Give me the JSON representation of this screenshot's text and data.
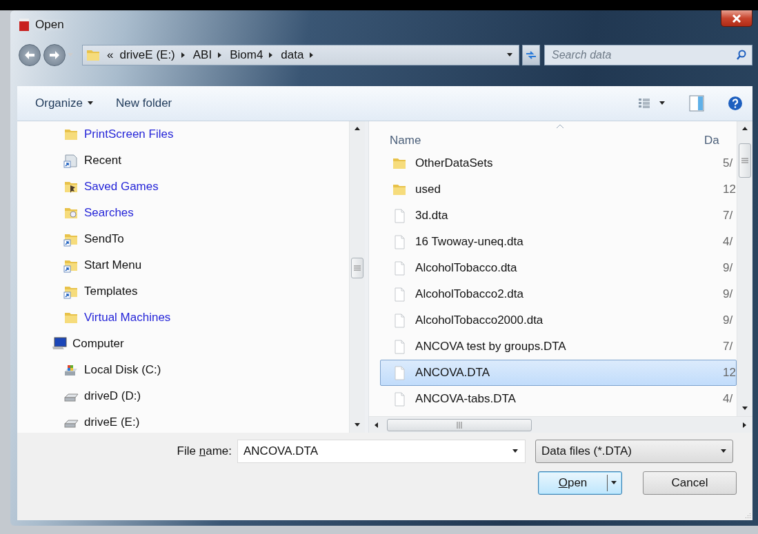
{
  "window": {
    "title": "Open"
  },
  "address_bar": {
    "overflow": "«",
    "path": [
      "driveE (E:)",
      "ABI",
      "Biom4",
      "data"
    ]
  },
  "search": {
    "placeholder": "Search data"
  },
  "toolbar": {
    "buttons": [
      {
        "label": "Organize",
        "dropdown": true
      },
      {
        "label": "New folder",
        "dropdown": false
      }
    ]
  },
  "navigation": {
    "tree": [
      {
        "children": [
          {
            "label": "PrintScreen Files",
            "kind": "folder",
            "compressed": true
          },
          {
            "label": "Recent",
            "kind": "recent",
            "compressed": false
          },
          {
            "label": "Saved Games",
            "kind": "saved-games",
            "compressed": true
          },
          {
            "label": "Searches",
            "kind": "searches",
            "compressed": true
          },
          {
            "label": "SendTo",
            "kind": "shortcut",
            "compressed": false
          },
          {
            "label": "Start Menu",
            "kind": "shortcut",
            "compressed": false
          },
          {
            "label": "Templates",
            "kind": "shortcut",
            "compressed": false
          },
          {
            "label": "Virtual Machines",
            "kind": "folder",
            "compressed": true
          }
        ]
      },
      {
        "label": "Computer",
        "kind": "computer",
        "compressed": false,
        "children": [
          {
            "label": "Local Disk (C:)",
            "kind": "system-disk",
            "compressed": false
          },
          {
            "label": "driveD (D:)",
            "kind": "drive",
            "compressed": false
          },
          {
            "label": "driveE (E:)",
            "kind": "drive",
            "compressed": false
          }
        ]
      }
    ]
  },
  "files": {
    "columns": [
      {
        "label": "Name",
        "sorted": true
      },
      {
        "label": "Da",
        "sorted": false
      }
    ],
    "rows": [
      {
        "name": "OtherDataSets",
        "column_2": "5/",
        "kind": "folder",
        "selected": false
      },
      {
        "name": "used",
        "column_2": "12",
        "kind": "folder",
        "selected": false
      },
      {
        "name": "3d.dta",
        "column_2": "7/",
        "kind": "file",
        "selected": false
      },
      {
        "name": "16 Twoway-uneq.dta",
        "column_2": "4/",
        "kind": "file",
        "selected": false
      },
      {
        "name": "AlcoholTobacco.dta",
        "column_2": "9/",
        "kind": "file",
        "selected": false
      },
      {
        "name": "AlcoholTobacco2.dta",
        "column_2": "9/",
        "kind": "file",
        "selected": false
      },
      {
        "name": "AlcoholTobacco2000.dta",
        "column_2": "9/",
        "kind": "file",
        "selected": false
      },
      {
        "name": "ANCOVA test by groups.DTA",
        "column_2": "7/",
        "kind": "file",
        "selected": false
      },
      {
        "name": "ANCOVA.DTA",
        "column_2": "12",
        "kind": "file",
        "selected": true
      },
      {
        "name": "ANCOVA-tabs.DTA",
        "column_2": "4/",
        "kind": "file",
        "selected": false
      }
    ]
  },
  "file_name": {
    "label_before": "File ",
    "access_key": "n",
    "label_after": "ame:",
    "value": "ANCOVA.DTA"
  },
  "file_type": {
    "value": "Data files (*.DTA)"
  },
  "buttons": [
    {
      "kind": "split",
      "access_key": "O",
      "label_after": "pen",
      "default": true
    },
    {
      "kind": "plain",
      "label": "Cancel",
      "default": false
    }
  ]
}
